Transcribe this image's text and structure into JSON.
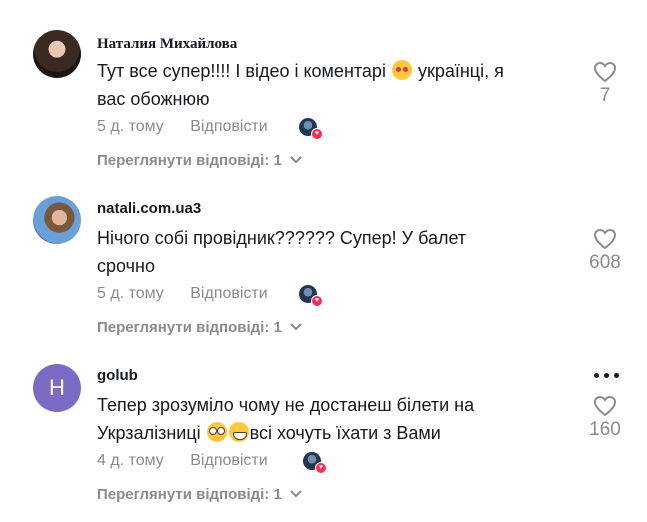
{
  "comments": [
    {
      "username": "Наталия Михайлова",
      "text_line1": "Тут все супер!!!! І відео і коментарі",
      "text_line1_after": " українці, я",
      "text_line2": "вас обожнюю",
      "emoji": "smiling-face-with-hearts",
      "time": "5 д. тому",
      "reply_label": "Відповісти",
      "view_replies": "Переглянути відповіді: 1",
      "likes": "7"
    },
    {
      "username": "natali.com.ua3",
      "text_line1": "Нічого собі провідник?????? Супер! У балет",
      "text_line2": "срочно",
      "time": "5 д. тому",
      "reply_label": "Відповісти",
      "view_replies": "Переглянути відповіді: 1",
      "likes": "608"
    },
    {
      "username": "golub",
      "avatar_letter": "H",
      "avatar_color": "#7c6bc4",
      "text_line1": "Тепер зрозуміло чому не достанеш білети на",
      "text_line2_before": "Укрзалізниці ",
      "text_line2_after": "всі хочуть їхати з Вами",
      "emojis": [
        "flushed-face",
        "grinning-face"
      ],
      "time": "4 д. тому",
      "reply_label": "Відповісти",
      "view_replies": "Переглянути відповіді: 1",
      "likes": "160"
    }
  ],
  "colors": {
    "text": "#161823",
    "secondary": "#8a8b91",
    "like_badge": "#fe2c55"
  },
  "icons": {
    "like": "heart-outline-icon",
    "expand": "chevron-down-icon",
    "more": "more-dots-icon"
  }
}
